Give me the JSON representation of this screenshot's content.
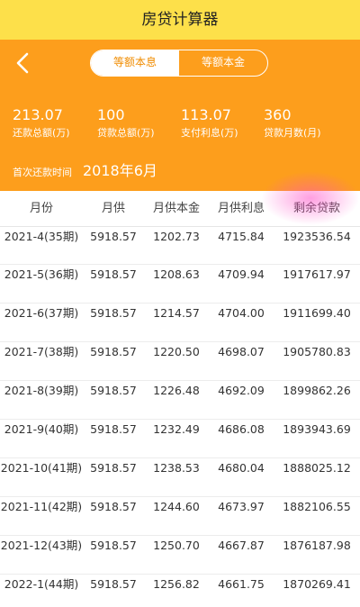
{
  "header": {
    "title": "房贷计算器"
  },
  "tabs": [
    {
      "label": "等额本息",
      "active": true
    },
    {
      "label": "等额本金",
      "active": false
    }
  ],
  "summary": {
    "total_repay": {
      "value": "213.07",
      "label": "还款总额(万)"
    },
    "loan_total": {
      "value": "100",
      "label": "贷款总额(万)"
    },
    "interest": {
      "value": "113.07",
      "label": "支付利息(万)"
    },
    "months": {
      "value": "360",
      "label": "贷款月数(月)"
    },
    "first_time": {
      "label": "首次还款时间",
      "value": "2018年6月"
    }
  },
  "table": {
    "columns": [
      "月份",
      "月供",
      "月供本金",
      "月供利息",
      "剩余贷款"
    ],
    "rows": [
      [
        "2021-4(35期)",
        "5918.57",
        "1202.73",
        "4715.84",
        "1923536.54"
      ],
      [
        "2021-5(36期)",
        "5918.57",
        "1208.63",
        "4709.94",
        "1917617.97"
      ],
      [
        "2021-6(37期)",
        "5918.57",
        "1214.57",
        "4704.00",
        "1911699.40"
      ],
      [
        "2021-7(38期)",
        "5918.57",
        "1220.50",
        "4698.07",
        "1905780.83"
      ],
      [
        "2021-8(39期)",
        "5918.57",
        "1226.48",
        "4692.09",
        "1899862.26"
      ],
      [
        "2021-9(40期)",
        "5918.57",
        "1232.49",
        "4686.08",
        "1893943.69"
      ],
      [
        "2021-10(41期)",
        "5918.57",
        "1238.53",
        "4680.04",
        "1888025.12"
      ],
      [
        "2021-11(42期)",
        "5918.57",
        "1244.60",
        "4673.97",
        "1882106.55"
      ],
      [
        "2021-12(43期)",
        "5918.57",
        "1250.70",
        "4667.87",
        "1876187.98"
      ],
      [
        "2022-1(44期)",
        "5918.57",
        "1256.82",
        "4661.75",
        "1870269.41"
      ]
    ]
  },
  "colors": {
    "title_bar": "#fde04a",
    "summary_bg": "#fd9e1c",
    "active_tab_text": "#f08c00"
  },
  "icons": {
    "back": "chevron-left-icon"
  }
}
